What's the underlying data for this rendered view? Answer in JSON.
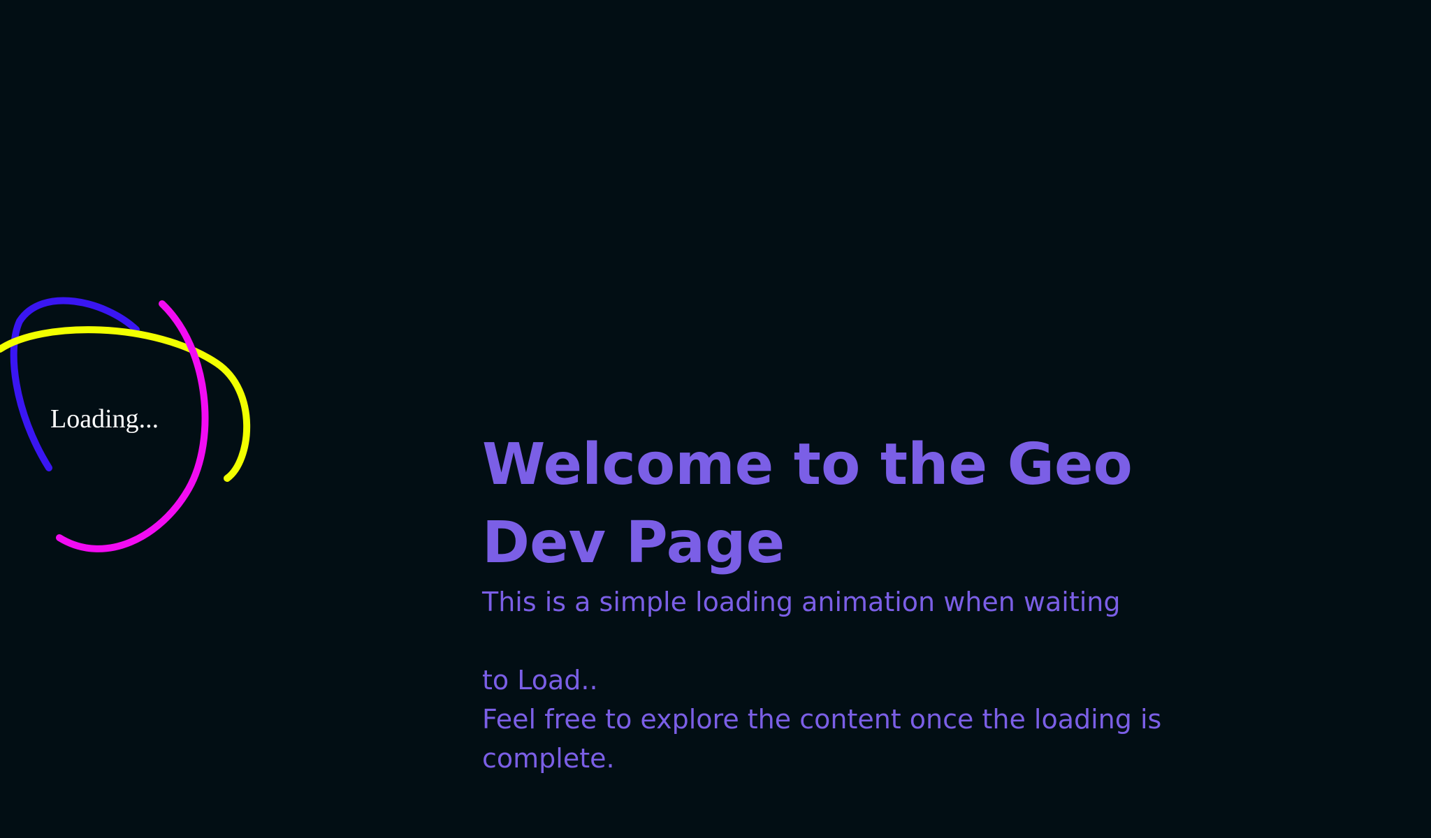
{
  "loader": {
    "text": "Loading...",
    "colors": {
      "ring_1": "#3a16f2",
      "ring_2": "#f2ff00",
      "ring_3": "#f20cf2"
    }
  },
  "main": {
    "title": "Welcome to the Geo Dev Page",
    "line_1": "This is a simple loading animation when waiting",
    "line_2": "to Load..",
    "line_3": "Feel free to explore the content once the loading is complete."
  },
  "colors": {
    "background": "#020e14",
    "text_accent": "#7b5fe6",
    "loader_text": "#ffffff"
  }
}
